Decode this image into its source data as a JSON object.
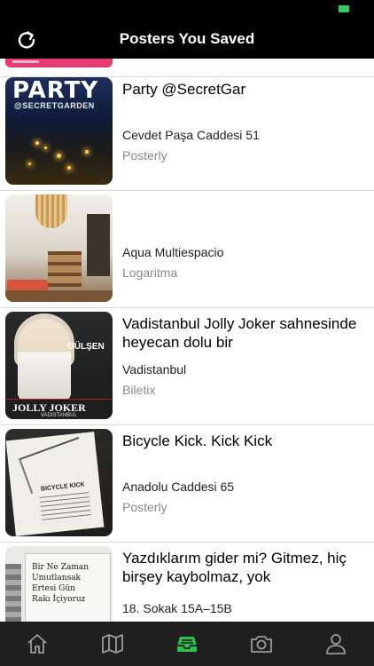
{
  "header": {
    "title": "Posters You Saved",
    "refresh_icon": "refresh-icon"
  },
  "colors": {
    "accent": "#2fbf4f",
    "nav_background": "#000000",
    "tab_bar_background": "#1f1f1f",
    "battery": "#34c759"
  },
  "posters": [
    {
      "title": "Party @SecretGar",
      "venue": "Cevdet Paşa Caddesi 51",
      "source": "Posterly",
      "thumb_text": "PARTY",
      "thumb_subtext": "@SECRETGARDEN"
    },
    {
      "title": "",
      "venue": "Aqua Multiespacio",
      "source": "Logaritma"
    },
    {
      "title": "Vadistanbul Jolly Joker sahnesinde heyecan dolu bir",
      "venue": "Vadistanbul",
      "source": "Biletix",
      "thumb_name": "GÜLŞEN",
      "thumb_bar": "JOLLY JOKER",
      "thumb_bar_sub": "VADISTANBUL"
    },
    {
      "title": "Bicycle Kick. Kick Kick",
      "venue": "Anadolu Caddesi 65",
      "source": "Posterly",
      "thumb_label": "BICYCLE KICK"
    },
    {
      "title": "Yazdıklarım gider mi? Gitmez, hiç birşey kaybolmaz, yok",
      "venue": "18. Sokak 15A–15B",
      "source": "",
      "thumb_writing": "Bir Ne Zaman\nUmutlansak\nErtesi Gün\nRakı İçiyoruz"
    }
  ],
  "tabs": [
    {
      "name": "home",
      "icon": "home-icon",
      "active": false
    },
    {
      "name": "map",
      "icon": "map-icon",
      "active": false
    },
    {
      "name": "saved",
      "icon": "inbox-tray-icon",
      "active": true
    },
    {
      "name": "camera",
      "icon": "camera-icon",
      "active": false
    },
    {
      "name": "profile",
      "icon": "user-icon",
      "active": false
    }
  ]
}
